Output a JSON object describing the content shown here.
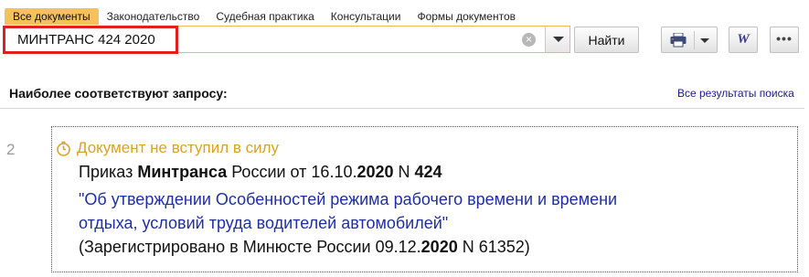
{
  "tabs": [
    {
      "label": "Все документы",
      "active": true
    },
    {
      "label": "Законодательство",
      "active": false
    },
    {
      "label": "Судебная практика",
      "active": false
    },
    {
      "label": "Консультации",
      "active": false
    },
    {
      "label": "Формы документов",
      "active": false
    }
  ],
  "search": {
    "value": "МИНТРАНС 424 2020",
    "find_label": "Найти",
    "clear_symbol": "×"
  },
  "toolbar": {
    "word_label": "W",
    "more_label": "•••"
  },
  "results": {
    "heading": "Наиболее соответствуют запросу:",
    "all_results_link": "Все результаты поиска",
    "items": [
      {
        "number": "2",
        "status": "Документ не вступил в силу",
        "status_color": "#d9a227",
        "line1": {
          "p1": "Приказ ",
          "b1": "Минтранса",
          "p2": " России от 16.10.",
          "b2": "2020",
          "p3": " N ",
          "b3": "424"
        },
        "title_line1": "\"Об утверждении Особенностей режима рабочего времени и времени",
        "title_line2": "отдыха, условий труда водителей автомобилей\"",
        "registration": {
          "p1": "(Зарегистрировано в Минюсте России 09.12.",
          "b1": "2020",
          "p2": " N 61352)"
        }
      }
    ]
  },
  "colors": {
    "accent_tab": "#f5c15e",
    "highlight_box": "#e02020",
    "link": "#1f2fa0"
  },
  "icons": [
    "clear-icon",
    "chevron-down-icon",
    "printer-icon",
    "word-icon",
    "more-icon",
    "clock-icon"
  ]
}
